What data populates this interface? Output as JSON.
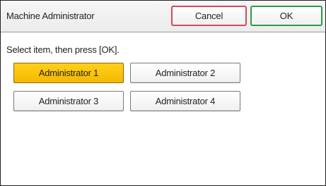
{
  "header": {
    "title": "Machine Administrator",
    "cancel_label": "Cancel",
    "ok_label": "OK"
  },
  "instruction": "Select item, then press [OK].",
  "administrators": [
    {
      "label": "Administrator 1",
      "selected": true
    },
    {
      "label": "Administrator 2",
      "selected": false
    },
    {
      "label": "Administrator 3",
      "selected": false
    },
    {
      "label": "Administrator 4",
      "selected": false
    }
  ],
  "colors": {
    "selected": "#f9c20a",
    "cancel_border": "#d24a5a",
    "ok_border": "#2f9a46"
  }
}
